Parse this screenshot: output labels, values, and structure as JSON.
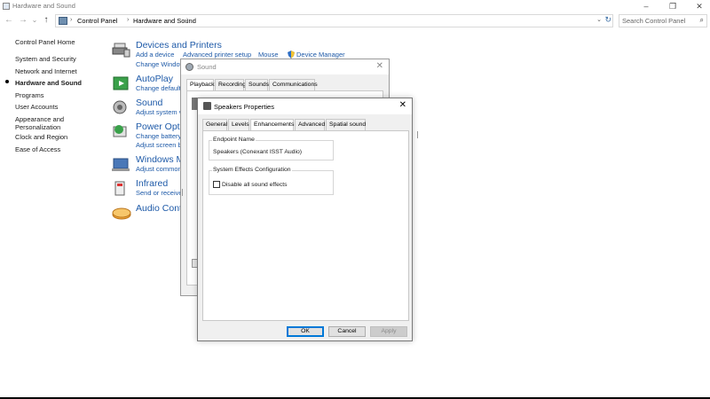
{
  "window": {
    "title": "Hardware and Sound",
    "controls": [
      "–",
      "❐",
      "✕"
    ]
  },
  "address": {
    "crumbs": [
      "Control Panel",
      "Hardware and Sound"
    ],
    "search_placeholder": "Search Control Panel"
  },
  "nav": {
    "back": "←",
    "forward": "→",
    "dropdown": "⌄",
    "up": "↑"
  },
  "leftnav": {
    "items": [
      "Control Panel Home",
      "System and Security",
      "Network and Internet",
      "Hardware and Sound",
      "Programs",
      "User Accounts",
      "Appearance and Personalization",
      "Clock and Region",
      "Ease of Access"
    ],
    "active_index": 3
  },
  "categories": [
    {
      "title": "Devices and Printers",
      "icon": "printer-icon",
      "links": [
        "Add a device",
        "Advanced printer setup",
        "Mouse",
        "Device Manager",
        "Change Windows"
      ]
    },
    {
      "title": "AutoPlay",
      "icon": "autoplay-icon",
      "links": [
        "Change default"
      ]
    },
    {
      "title": "Sound",
      "icon": "speaker-icon",
      "links": [
        "Adjust system v"
      ]
    },
    {
      "title": "Power Optio",
      "icon": "power-icon",
      "links": [
        "Change battery",
        "Adjust screen b"
      ]
    },
    {
      "title": "Windows Me",
      "icon": "mobility-icon",
      "links": [
        "Adjust common"
      ]
    },
    {
      "title": "Infrared",
      "icon": "infrared-icon",
      "links": [
        "Send or receive a"
      ]
    },
    {
      "title": "Audio Contro",
      "icon": "audio-icon",
      "links": []
    }
  ],
  "sound_dialog": {
    "title": "Sound",
    "tabs": [
      "Playback",
      "Recording",
      "Sounds",
      "Communications"
    ],
    "selected_tab": 0
  },
  "speakers_dialog": {
    "title": "Speakers Properties",
    "tabs": [
      "General",
      "Levels",
      "Enhancements",
      "Advanced",
      "Spatial sound"
    ],
    "selected_tab": 2,
    "endpoint_label": "Endpoint Name",
    "endpoint_value": "Speakers (Conexant ISST Audio)",
    "effects_label": "System Effects Configuration",
    "disable_effects_label": "Disable all sound effects",
    "disable_effects_checked": false,
    "buttons": {
      "ok": "OK",
      "cancel": "Cancel",
      "apply": "Apply"
    }
  },
  "colors": {
    "link": "#1e5aa8",
    "accent": "#0078d7"
  }
}
